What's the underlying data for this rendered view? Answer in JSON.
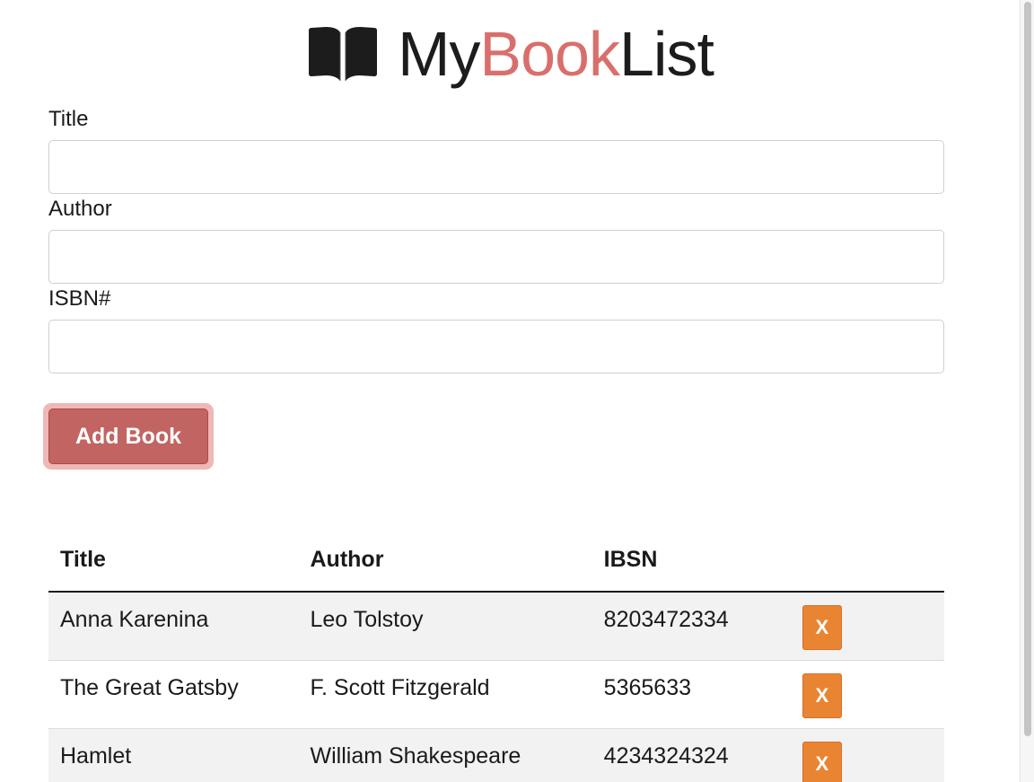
{
  "header": {
    "title_part1": "My",
    "title_part2": "Book",
    "title_part3": "List",
    "icon": "book-open-icon",
    "accent_color": "#d96f6c"
  },
  "form": {
    "title_label": "Title",
    "title_value": "",
    "author_label": "Author",
    "author_value": "",
    "isbn_label": "ISBN#",
    "isbn_value": "",
    "submit_label": "Add Book",
    "submit_color": "#c26462"
  },
  "table": {
    "headers": [
      "Title",
      "Author",
      "IBSN"
    ],
    "rows": [
      {
        "title": "Anna Karenina",
        "author": "Leo Tolstoy",
        "isbn": "8203472334",
        "delete_label": "X"
      },
      {
        "title": "The Great Gatsby",
        "author": "F. Scott Fitzgerald",
        "isbn": "5365633",
        "delete_label": "X"
      },
      {
        "title": "Hamlet",
        "author": "William Shakespeare",
        "isbn": "4234324324",
        "delete_label": "X"
      }
    ],
    "delete_color": "#e98433"
  }
}
